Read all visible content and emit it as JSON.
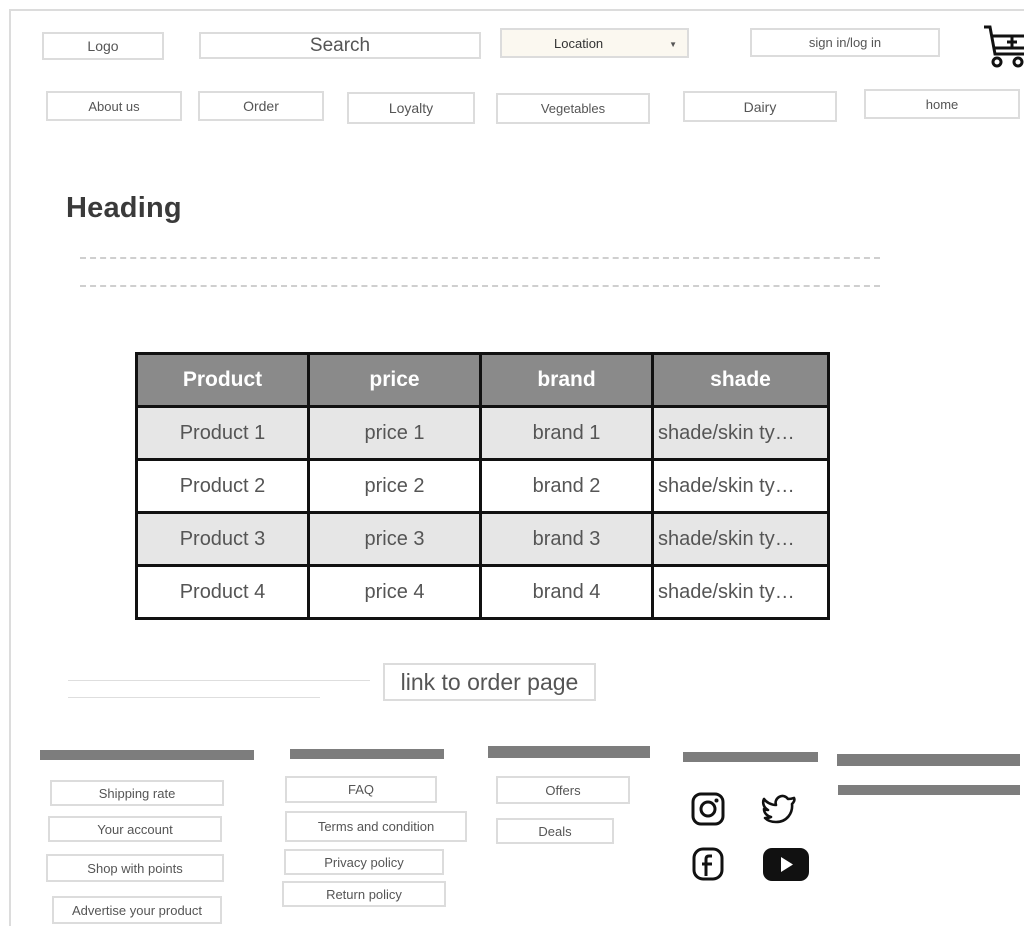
{
  "header": {
    "logo": "Logo",
    "search_placeholder": "Search",
    "location": "Location",
    "signin": "sign in/log in"
  },
  "nav": {
    "about": "About us",
    "order": "Order",
    "loyalty": "Loyalty",
    "vegetables": "Vegetables",
    "dairy": "Dairy",
    "home": "home"
  },
  "main": {
    "heading": "Heading",
    "table": {
      "headers": [
        "Product",
        "price",
        "brand",
        "shade"
      ],
      "rows": [
        [
          "Product 1",
          "price 1",
          "brand 1",
          "shade/skin ty…"
        ],
        [
          "Product 2",
          "price 2",
          "brand 2",
          "shade/skin ty…"
        ],
        [
          "Product 3",
          "price 3",
          "brand 3",
          "shade/skin ty…"
        ],
        [
          "Product 4",
          "price 4",
          "brand 4",
          "shade/skin ty…"
        ]
      ]
    },
    "order_link": "link to order page"
  },
  "footer": {
    "col1": [
      "Shipping rate",
      "Your account",
      "Shop with points",
      "Advertise your product"
    ],
    "col2": [
      "FAQ",
      "Terms and condition",
      "Privacy policy",
      "Return policy"
    ],
    "col3": [
      "Offers",
      "Deals"
    ],
    "social_icons": [
      "instagram-icon",
      "twitter-icon",
      "facebook-icon",
      "youtube-icon"
    ]
  }
}
